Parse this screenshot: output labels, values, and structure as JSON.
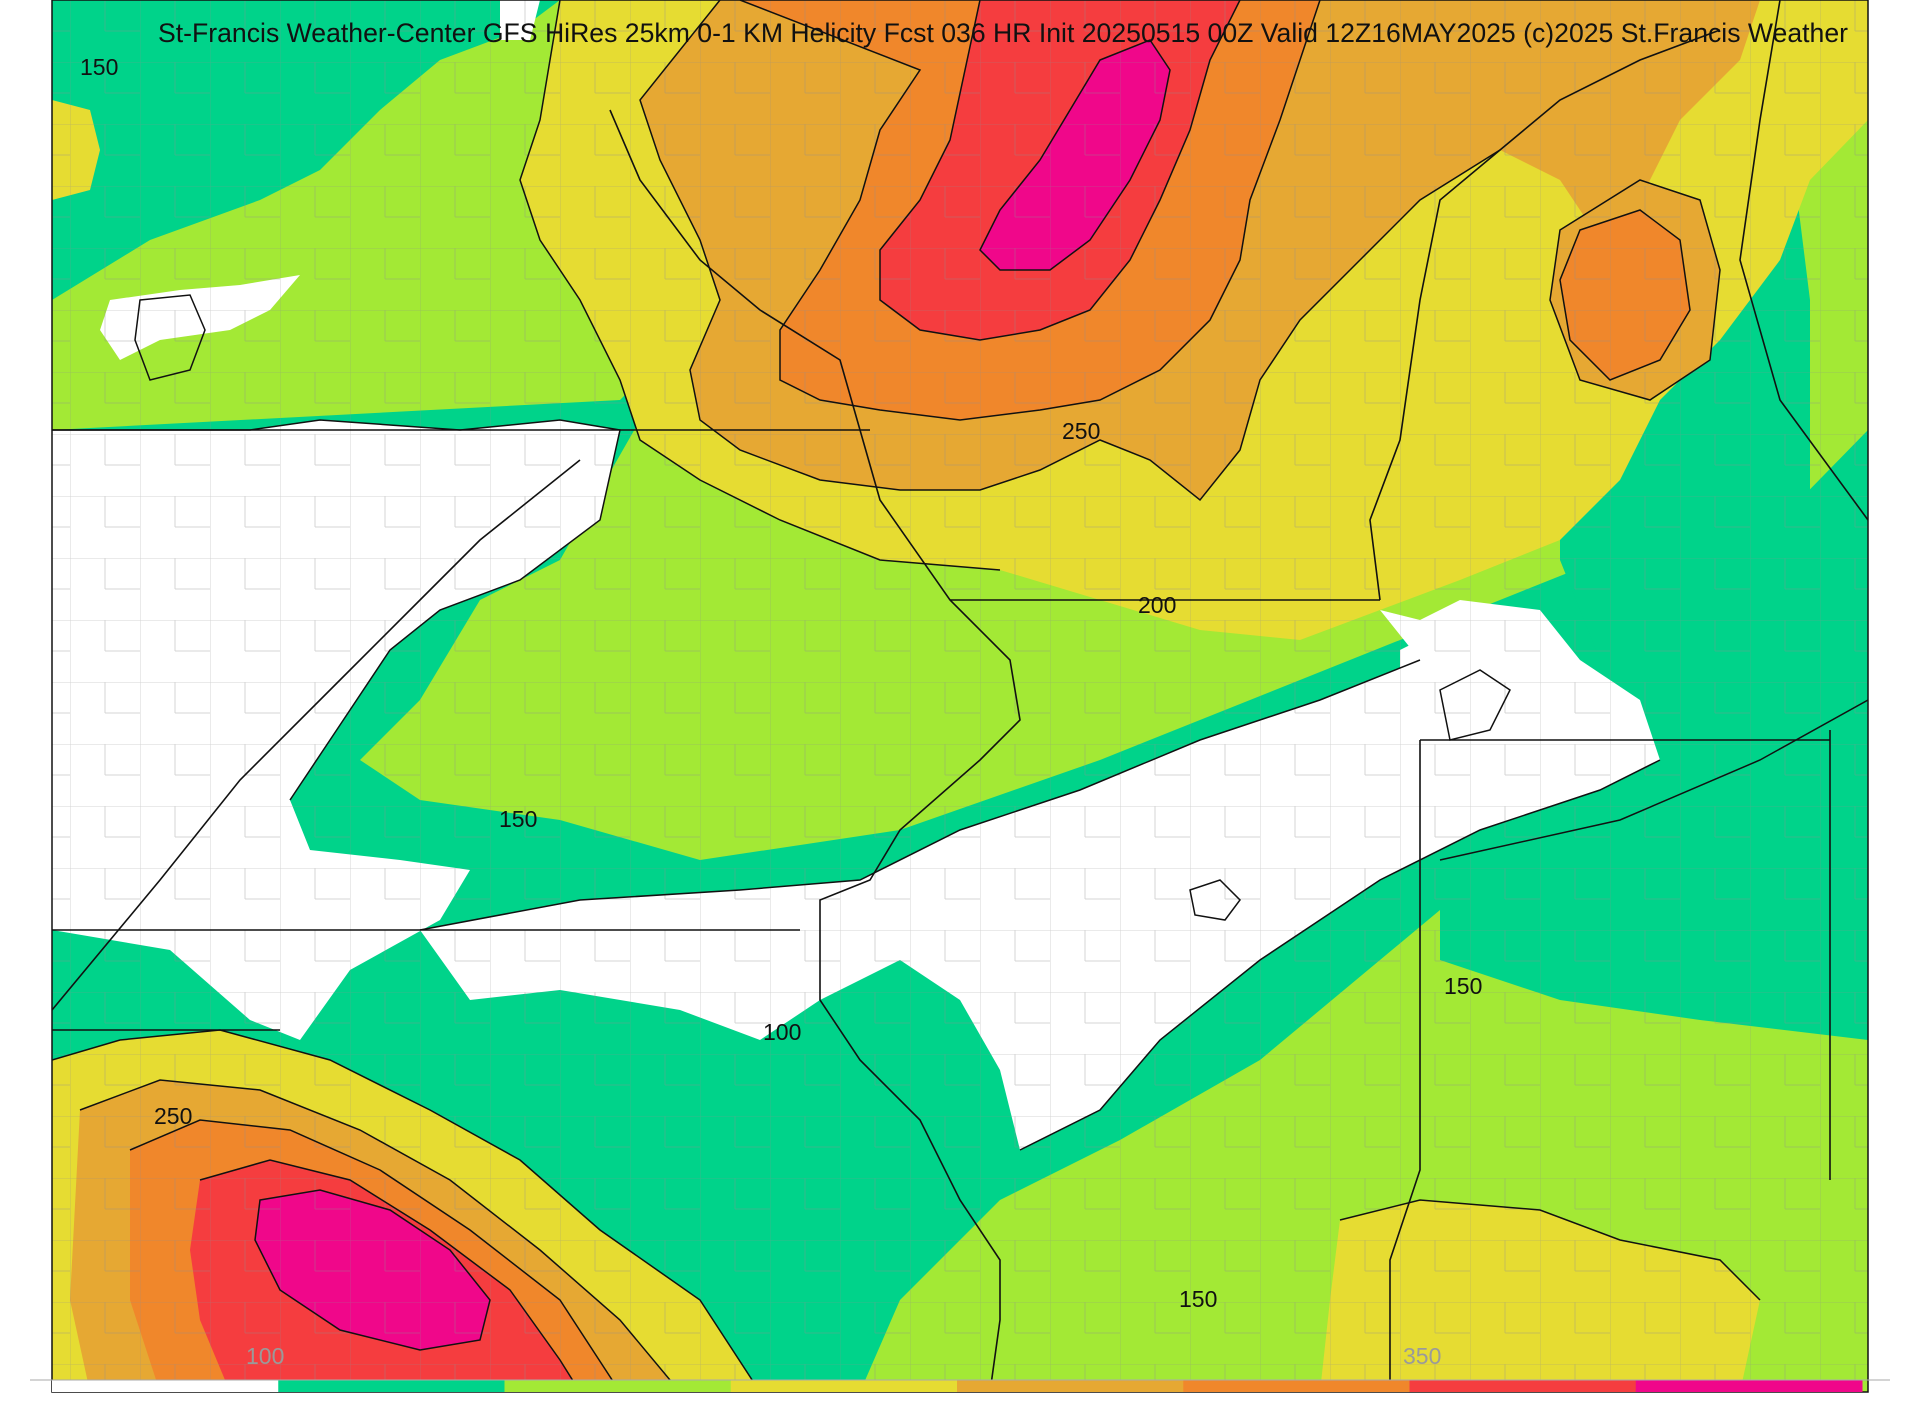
{
  "map": {
    "title": "St-Francis Weather-Center GFS HiRes 25km 0-1 KM Helicity Fcst 036 HR Init 20250515 00Z  Valid 12Z16MAY2025    (c)2025 St.Francis Weather",
    "contour_labels": [
      {
        "id": "nw",
        "text": "150"
      },
      {
        "id": "north",
        "text": "250"
      },
      {
        "id": "center",
        "text": "200"
      },
      {
        "id": "west",
        "text": "150"
      },
      {
        "id": "south",
        "text": "100"
      },
      {
        "id": "east",
        "text": "150"
      },
      {
        "id": "sw",
        "text": "250"
      },
      {
        "id": "se",
        "text": "150"
      }
    ],
    "colorbar": {
      "tick_labels": [
        "100",
        "350"
      ],
      "colors": [
        "#ffffff",
        "#00d38a",
        "#a3e935",
        "#e6dc32",
        "#e6a833",
        "#f0872b",
        "#f53d3f",
        "#f0078a"
      ]
    },
    "levels": [
      {
        "range": "<100",
        "color": "#ffffff"
      },
      {
        "range": "100-150",
        "color": "#00d38a"
      },
      {
        "range": "150-200",
        "color": "#a3e935"
      },
      {
        "range": "200-250",
        "color": "#e6dc32"
      },
      {
        "range": "250-300",
        "color": "#e6a833"
      },
      {
        "range": "300-350",
        "color": "#f0872b"
      },
      {
        "range": "350-400",
        "color": "#f53d3f"
      },
      {
        "range": ">400",
        "color": "#f0078a"
      }
    ]
  }
}
